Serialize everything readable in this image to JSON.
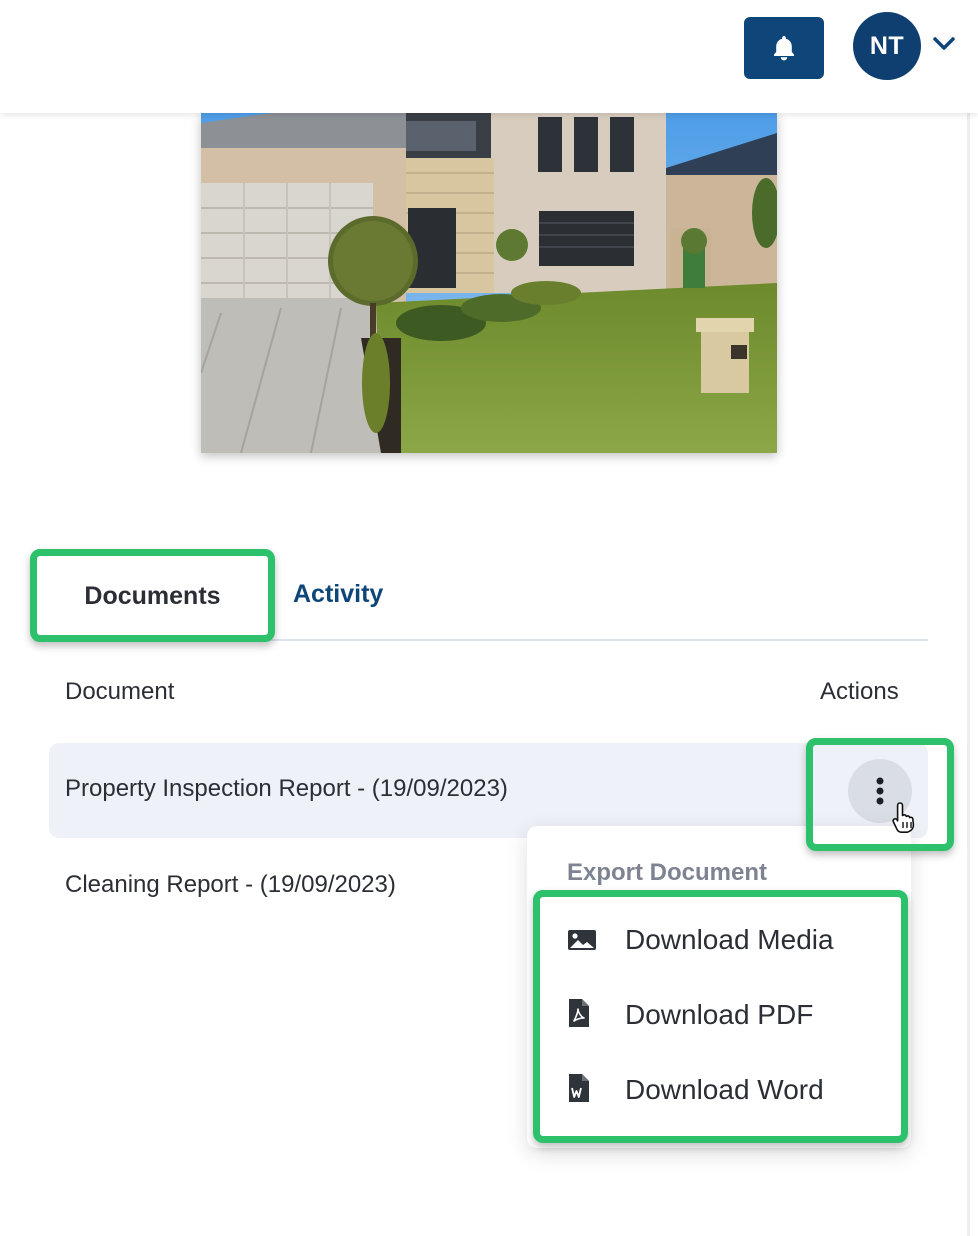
{
  "header": {
    "avatar_initials": "NT",
    "icons": [
      "bell-icon",
      "chevron-down-icon"
    ],
    "colors": {
      "primary": "#0f4679",
      "highlight": "#2cc16a"
    }
  },
  "tabs": [
    {
      "label": "Documents",
      "active": true
    },
    {
      "label": "Activity",
      "active": false
    }
  ],
  "table": {
    "columns": {
      "document": "Document",
      "actions": "Actions"
    },
    "rows": [
      {
        "name": "Property Inspection Report - (19/09/2023)"
      },
      {
        "name": "Cleaning Report - (19/09/2023)"
      }
    ]
  },
  "export_menu": {
    "title": "Export Document",
    "items": [
      {
        "label": "Download Media",
        "icon": "image-icon"
      },
      {
        "label": "Download PDF",
        "icon": "pdf-file-icon"
      },
      {
        "label": "Download Word",
        "icon": "word-file-icon"
      }
    ]
  }
}
